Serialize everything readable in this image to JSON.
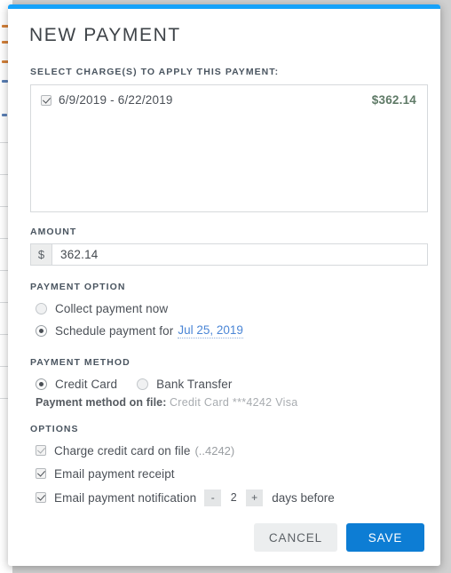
{
  "modal": {
    "title": "NEW PAYMENT",
    "accent_color": "#16a2fa"
  },
  "charges": {
    "label": "SELECT CHARGE(S) TO APPLY THIS PAYMENT:",
    "rows": [
      {
        "checked": true,
        "date_range": "6/9/2019 - 6/22/2019",
        "amount": "$362.14"
      }
    ]
  },
  "amount": {
    "label": "AMOUNT",
    "currency_prefix": "$",
    "value": "362.14",
    "placeholder": "0.00"
  },
  "payment_option": {
    "label": "PAYMENT OPTION",
    "options": [
      {
        "label": "Collect payment now",
        "selected": false
      },
      {
        "label": "Schedule payment for",
        "selected": true
      }
    ],
    "scheduled_date": "Jul 25, 2019"
  },
  "payment_method": {
    "label": "PAYMENT METHOD",
    "options": [
      {
        "label": "Credit Card",
        "selected": true
      },
      {
        "label": "Bank Transfer",
        "selected": false
      }
    ],
    "on_file_label": "Payment method on file:",
    "on_file_value": "Credit Card ***4242 Visa"
  },
  "options": {
    "label": "OPTIONS",
    "items": [
      {
        "label": "Charge credit card on file",
        "suffix": "(..4242)",
        "checked": true,
        "disabled": true
      },
      {
        "label": "Email payment receipt",
        "suffix": "",
        "checked": true,
        "disabled": false
      },
      {
        "label": "Email payment notification",
        "suffix": "",
        "checked": true,
        "disabled": false
      }
    ],
    "stepper": {
      "decrement_label": "-",
      "value": "2",
      "increment_label": "+",
      "after_label": "days before"
    }
  },
  "footer": {
    "cancel_label": "CANCEL",
    "save_label": "SAVE",
    "save_color": "#0d7dd4"
  }
}
